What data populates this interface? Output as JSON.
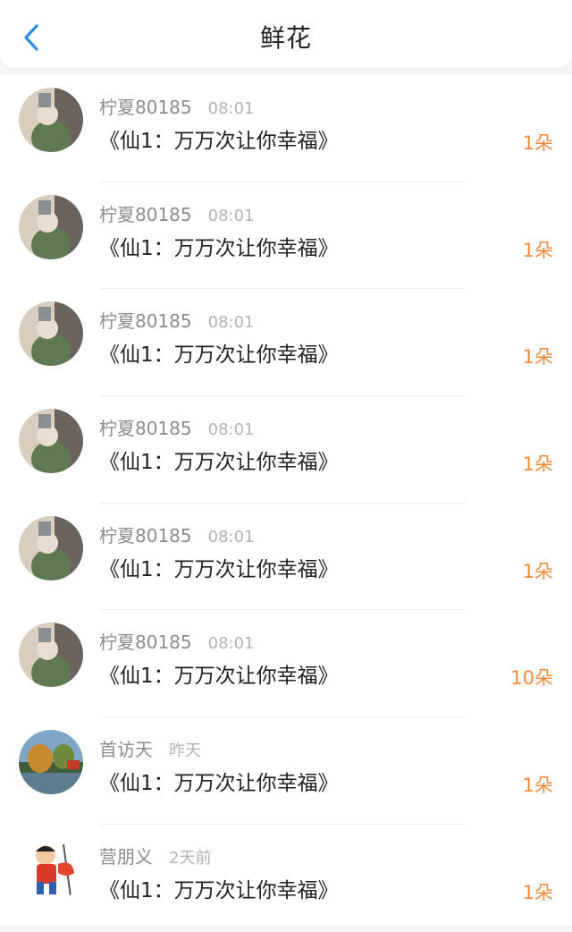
{
  "header": {
    "title": "鲜花"
  },
  "colors": {
    "accent": "#2e8ce6",
    "count": "#f28a3c"
  },
  "items": [
    {
      "name": "柠夏80185",
      "time": "08:01",
      "book": "《仙1：万万次让你幸福》",
      "count": "1朵",
      "avatar": "girl-photo"
    },
    {
      "name": "柠夏80185",
      "time": "08:01",
      "book": "《仙1：万万次让你幸福》",
      "count": "1朵",
      "avatar": "girl-photo"
    },
    {
      "name": "柠夏80185",
      "time": "08:01",
      "book": "《仙1：万万次让你幸福》",
      "count": "1朵",
      "avatar": "girl-photo"
    },
    {
      "name": "柠夏80185",
      "time": "08:01",
      "book": "《仙1：万万次让你幸福》",
      "count": "1朵",
      "avatar": "girl-photo"
    },
    {
      "name": "柠夏80185",
      "time": "08:01",
      "book": "《仙1：万万次让你幸福》",
      "count": "1朵",
      "avatar": "girl-photo"
    },
    {
      "name": "柠夏80185",
      "time": "08:01",
      "book": "《仙1：万万次让你幸福》",
      "count": "10朵",
      "avatar": "girl-photo"
    },
    {
      "name": "首访天",
      "time": "昨天",
      "book": "《仙1：万万次让你幸福》",
      "count": "1朵",
      "avatar": "landscape-photo"
    },
    {
      "name": "营朋义",
      "time": "2天前",
      "book": "《仙1：万万次让你幸福》",
      "count": "1朵",
      "avatar": "cartoon-character"
    }
  ]
}
